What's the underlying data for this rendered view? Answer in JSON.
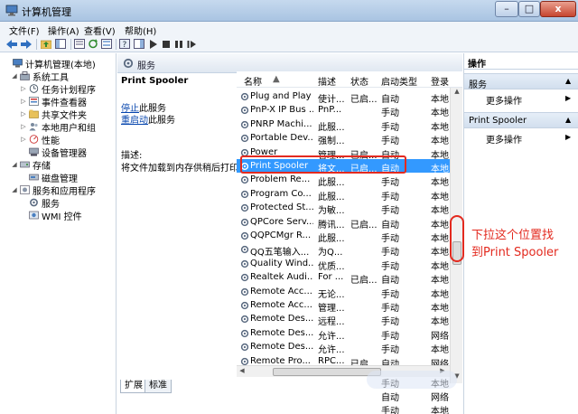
{
  "window": {
    "title": "计算机管理",
    "minimize_label": "–",
    "maximize_label": "□",
    "close_label": "x"
  },
  "menu": [
    "文件(F)",
    "操作(A)",
    "查看(V)",
    "帮助(H)"
  ],
  "tree": [
    {
      "label": "计算机管理(本地)",
      "icon": "computer-management-icon",
      "depth": 0,
      "arrow": ""
    },
    {
      "label": "系统工具",
      "icon": "tools-icon",
      "depth": 1,
      "arrow": "◢"
    },
    {
      "label": "任务计划程序",
      "icon": "clock-icon",
      "depth": 2,
      "arrow": "▷"
    },
    {
      "label": "事件查看器",
      "icon": "event-viewer-icon",
      "depth": 2,
      "arrow": "▷"
    },
    {
      "label": "共享文件夹",
      "icon": "shared-folder-icon",
      "depth": 2,
      "arrow": "▷"
    },
    {
      "label": "本地用户和组",
      "icon": "users-icon",
      "depth": 2,
      "arrow": "▷"
    },
    {
      "label": "性能",
      "icon": "performance-icon",
      "depth": 2,
      "arrow": "▷"
    },
    {
      "label": "设备管理器",
      "icon": "device-manager-icon",
      "depth": 2,
      "arrow": ""
    },
    {
      "label": "存储",
      "icon": "storage-icon",
      "depth": 1,
      "arrow": "◢"
    },
    {
      "label": "磁盘管理",
      "icon": "disk-icon",
      "depth": 2,
      "arrow": ""
    },
    {
      "label": "服务和应用程序",
      "icon": "services-apps-icon",
      "depth": 1,
      "arrow": "◢"
    },
    {
      "label": "服务",
      "icon": "services-icon",
      "depth": 2,
      "arrow": ""
    },
    {
      "label": "WMI 控件",
      "icon": "wmi-icon",
      "depth": 2,
      "arrow": ""
    }
  ],
  "middle": {
    "header": "服务",
    "service_name": "Print Spooler",
    "stop_link": "停止",
    "stop_suffix": "此服务",
    "restart_link": "重启动",
    "restart_suffix": "此服务",
    "desc_label": "描述:",
    "desc_text": "将文件加载到内存供稍后打印"
  },
  "columns": {
    "name": "名称",
    "desc": "描述",
    "status": "状态",
    "startup": "启动类型",
    "logon": "登录"
  },
  "rows": [
    {
      "name": "Plug and Play",
      "desc": "使计...",
      "status": "已启...",
      "startup": "自动",
      "logon": "本地"
    },
    {
      "name": "PnP-X IP Bus ...",
      "desc": "PnP...",
      "status": "",
      "startup": "手动",
      "logon": "本地"
    },
    {
      "name": "PNRP Machi...",
      "desc": "此服...",
      "status": "",
      "startup": "手动",
      "logon": "本地"
    },
    {
      "name": "Portable Dev...",
      "desc": "强制...",
      "status": "",
      "startup": "手动",
      "logon": "本地"
    },
    {
      "name": "Power",
      "desc": "管理...",
      "status": "已启...",
      "startup": "自动",
      "logon": "本地"
    },
    {
      "name": "Print Spooler",
      "desc": "将文...",
      "status": "已启...",
      "startup": "自动",
      "logon": "本地",
      "selected": true
    },
    {
      "name": "Problem Re...",
      "desc": "此服...",
      "status": "",
      "startup": "手动",
      "logon": "本地"
    },
    {
      "name": "Program Co...",
      "desc": "此服...",
      "status": "",
      "startup": "手动",
      "logon": "本地"
    },
    {
      "name": "Protected St...",
      "desc": "为敏...",
      "status": "",
      "startup": "手动",
      "logon": "本地"
    },
    {
      "name": "QPCore Serv...",
      "desc": "腾讯...",
      "status": "已启...",
      "startup": "自动",
      "logon": "本地"
    },
    {
      "name": "QQPCMgr R...",
      "desc": "此服...",
      "status": "",
      "startup": "手动",
      "logon": "本地"
    },
    {
      "name": "QQ五笔输入...",
      "desc": "为Q...",
      "status": "",
      "startup": "手动",
      "logon": "本地"
    },
    {
      "name": "Quality Wind...",
      "desc": "优质...",
      "status": "",
      "startup": "手动",
      "logon": "本地"
    },
    {
      "name": "Realtek Audi...",
      "desc": "For ...",
      "status": "已启...",
      "startup": "自动",
      "logon": "本地"
    },
    {
      "name": "Remote Acc...",
      "desc": "无论...",
      "status": "",
      "startup": "手动",
      "logon": "本地"
    },
    {
      "name": "Remote Acc...",
      "desc": "管理...",
      "status": "",
      "startup": "手动",
      "logon": "本地"
    },
    {
      "name": "Remote Des...",
      "desc": "远程...",
      "status": "",
      "startup": "手动",
      "logon": "本地"
    },
    {
      "name": "Remote Des...",
      "desc": "允许...",
      "status": "",
      "startup": "手动",
      "logon": "网络"
    },
    {
      "name": "Remote Des...",
      "desc": "允许...",
      "status": "",
      "startup": "手动",
      "logon": "本地"
    },
    {
      "name": "Remote Pro...",
      "desc": "RPC...",
      "status": "已启...",
      "startup": "自动",
      "logon": "网络"
    }
  ],
  "overflow_rows": [
    {
      "startup": "手动",
      "logon": "本地"
    },
    {
      "startup": "自动",
      "logon": "网络"
    },
    {
      "startup": "手动",
      "logon": "本地"
    }
  ],
  "tabs": [
    "扩展",
    "标准"
  ],
  "actions": {
    "title": "操作",
    "sections": [
      {
        "label": "服务",
        "more": "更多操作"
      },
      {
        "label": "Print Spooler",
        "more": "更多操作"
      }
    ]
  },
  "annotation": {
    "line1": "下拉这个位置找",
    "line2": "到Print Spooler"
  },
  "colors": {
    "annotation": "#e32a1f",
    "selection": "#3399ff",
    "link": "#0645ad"
  }
}
